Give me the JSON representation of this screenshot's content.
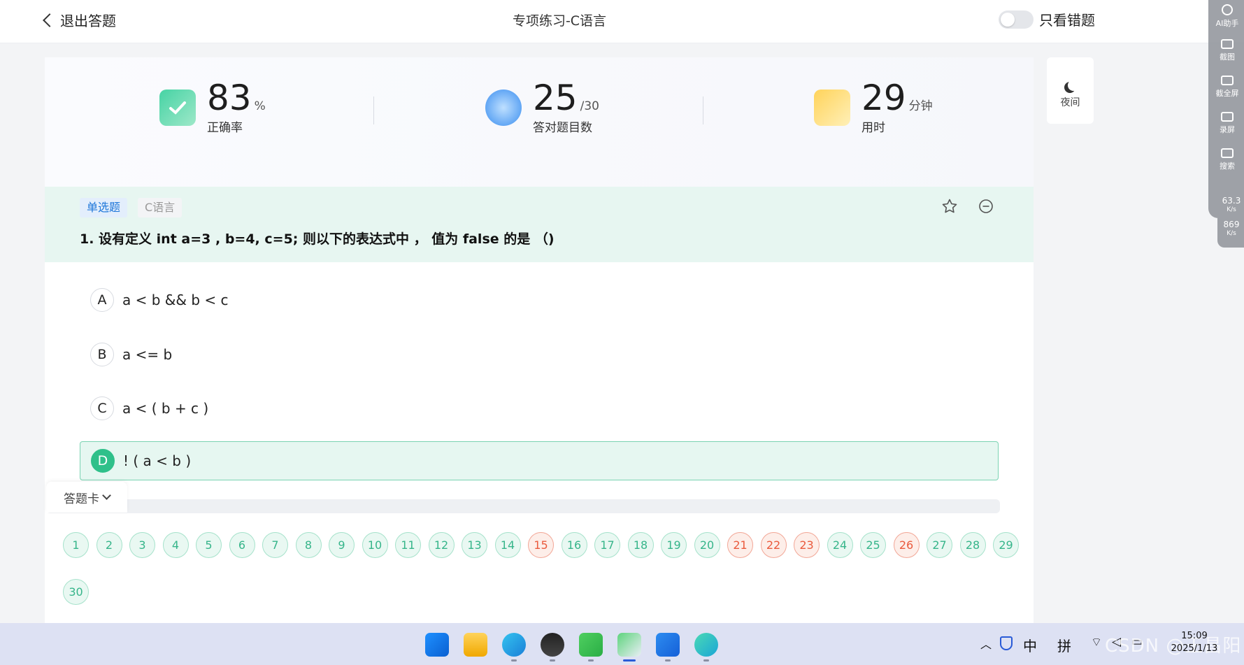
{
  "header": {
    "back_label": "退出答题",
    "title": "专项练习-C语言",
    "toggle_label": "只看错题",
    "toggle_on": false
  },
  "side_tools": [
    {
      "icon": "ai-assistant-icon",
      "label": "AI助手"
    },
    {
      "icon": "screenshot-icon",
      "label": "截图"
    },
    {
      "icon": "fullscreen-capture-icon",
      "label": "截全屏"
    },
    {
      "icon": "record-icon",
      "label": "录屏"
    },
    {
      "icon": "search-icon",
      "label": "搜索"
    }
  ],
  "net_speed": [
    {
      "value": "63.3",
      "unit": "K/s"
    },
    {
      "value": "869",
      "unit": "K/s"
    }
  ],
  "stats": {
    "accuracy": {
      "value": "83",
      "unit": "%",
      "label": "正确率",
      "icon": "check-book-icon"
    },
    "correct": {
      "value": "25",
      "unit": "/30",
      "label": "答对题目数",
      "icon": "medal-icon"
    },
    "time": {
      "value": "29",
      "unit": "分钟",
      "label": "用时",
      "icon": "clock-note-icon"
    }
  },
  "question": {
    "type_tag": "单选题",
    "lang_tag": "C语言",
    "text": "1. 设有定义 int a=3 , b=4, c=5;  则以下的表达式中 ， 值为 false 的是 （)",
    "options": [
      {
        "letter": "A",
        "text": "a < b && b < c",
        "selected": false
      },
      {
        "letter": "B",
        "text": "a <= b",
        "selected": false
      },
      {
        "letter": "C",
        "text": "a < ( b + c )",
        "selected": false
      },
      {
        "letter": "D",
        "text": "! ( a < b )",
        "selected": true
      }
    ]
  },
  "night_mode": {
    "label": "夜间"
  },
  "answer_card": {
    "label": "答题卡",
    "numbers": [
      "1",
      "2",
      "3",
      "4",
      "5",
      "6",
      "7",
      "8",
      "9",
      "10",
      "11",
      "12",
      "13",
      "14",
      "15",
      "16",
      "17",
      "18",
      "19",
      "20",
      "21",
      "22",
      "23",
      "24",
      "25",
      "26",
      "27",
      "28",
      "29",
      "30"
    ],
    "wrong": [
      "15",
      "21",
      "22",
      "23",
      "26"
    ]
  },
  "colors": {
    "accent_green": "#2fc08a",
    "wrong_red": "#ea5a3d",
    "tag_blue": "#1d76d9"
  },
  "taskbar": {
    "apps": [
      "windows-start-icon",
      "file-explorer-icon",
      "edge-browser-icon",
      "qq-icon",
      "wechat-icon",
      "remote-desktop-icon",
      "meitu-icon",
      "sogou-icon"
    ],
    "tray": {
      "ime_lang": "中",
      "ime_mode": "拼"
    },
    "clock_time": "15:09",
    "clock_date": "2025/1/13",
    "watermark": "CSDN @王昌阳"
  }
}
